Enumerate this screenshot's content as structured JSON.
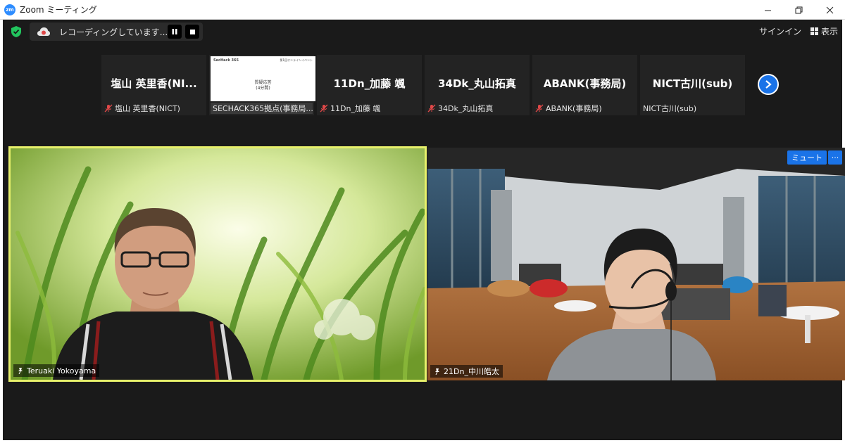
{
  "window": {
    "logo_text": "zm",
    "title": "Zoom ミーティング"
  },
  "toolbar": {
    "recording_text": "レコーディングしています...",
    "signin_label": "サインイン",
    "view_label": "表示"
  },
  "thumbnails": [
    {
      "name": "塩山 英里香(NI...",
      "label": "塩山 英里香(NICT)",
      "muted": true
    },
    {
      "slide_logo": "SecHack 365",
      "slide_event": "第1回オンラインイベント",
      "slide_title_1": "質疑応答",
      "slide_title_2": "(4分間)",
      "label": "SECHACK365拠点(事務局..."
    },
    {
      "name": "11Dn_加藤 颯",
      "label": "11Dn_加藤 颯",
      "muted": true
    },
    {
      "name": "34Dk_丸山拓真",
      "label": "34Dk_丸山拓真",
      "muted": true
    },
    {
      "name": "ABANK(事務局)",
      "label": "ABANK(事務局)",
      "muted": true
    },
    {
      "name": "NICT古川(sub)",
      "label": "NICT古川(sub)",
      "muted": false
    }
  ],
  "videos": {
    "left": {
      "name": "Teruaki Yokoyama"
    },
    "right": {
      "name": "21Dn_中川皓太",
      "mute_label": "ミュート",
      "more_label": "···"
    }
  },
  "colors": {
    "active_speaker_border": "#e7f06b",
    "accent": "#1a73e8",
    "background": "#1a1a1a",
    "muted_mic": "#e04848",
    "secure_shield": "#22c55e"
  },
  "icons": [
    "shield-check-icon",
    "cloud-record-icon",
    "pause-icon",
    "stop-icon",
    "grid-view-icon",
    "mic-off-icon",
    "chevron-right-icon",
    "pin-icon"
  ]
}
